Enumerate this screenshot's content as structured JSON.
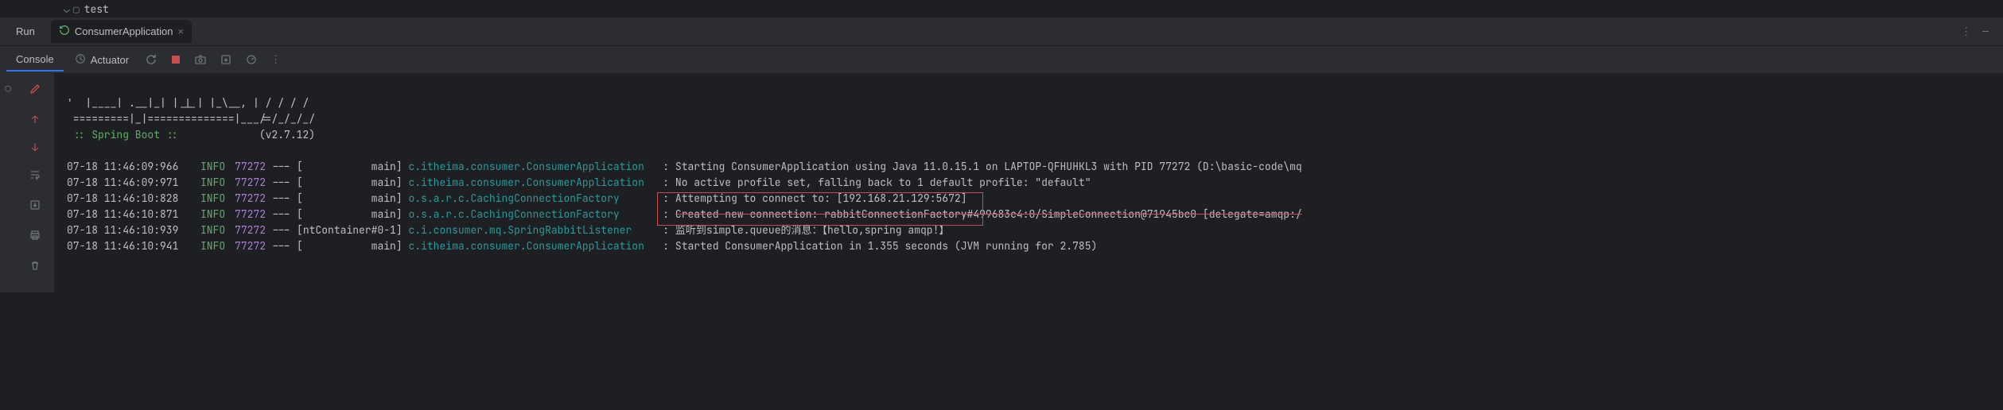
{
  "tree": {
    "folder": "test"
  },
  "toolWindow": {
    "runLabel": "Run",
    "appName": "ConsumerApplication"
  },
  "consoleBar": {
    "consoleTab": "Console",
    "actuator": "Actuator"
  },
  "banner": {
    "line1": "'  |____| .__|_| |_|_| |_\\__, | / / / /",
    "line2": " =========|_|==============|___/=/_/_/_/",
    "springLabel": " :: Spring Boot ::",
    "version": "(v2.7.12)"
  },
  "logLines": [
    {
      "ts": "07-18 11:46:09:966",
      "level": "INFO",
      "pid": "77272",
      "thread": "           main",
      "logger": "c.itheima.consumer.ConsumerApplication  ",
      "msg": "Starting ConsumerApplication using Java 11.0.15.1 on LAPTOP-QFHUHKL3 with PID 77272 (D:\\basic-code\\mq"
    },
    {
      "ts": "07-18 11:46:09:971",
      "level": "INFO",
      "pid": "77272",
      "thread": "           main",
      "logger": "c.itheima.consumer.ConsumerApplication  ",
      "msg": "No active profile set, falling back to 1 default profile: \"default\""
    },
    {
      "ts": "07-18 11:46:10:828",
      "level": "INFO",
      "pid": "77272",
      "thread": "           main",
      "logger": "o.s.a.r.c.CachingConnectionFactory      ",
      "msg": "Attempting to connect to: [192.168.21.129:5672]"
    },
    {
      "ts": "07-18 11:46:10:871",
      "level": "INFO",
      "pid": "77272",
      "thread": "           main",
      "logger": "o.s.a.r.c.CachingConnectionFactory      ",
      "msg": "Created new connection: rabbitConnectionFactory#499683c4:0/SimpleConnection@71945bc0 [delegate=amqp:/",
      "strike": true
    },
    {
      "ts": "07-18 11:46:10:939",
      "level": "INFO",
      "pid": "77272",
      "thread": "ntContainer#0-1",
      "logger": "c.i.consumer.mq.SpringRabbitListener    ",
      "msg": "监听到simple.queue的消息：【hello,spring amqp!】"
    },
    {
      "ts": "07-18 11:46:10:941",
      "level": "INFO",
      "pid": "77272",
      "thread": "           main",
      "logger": "c.itheima.consumer.ConsumerApplication  ",
      "msg": "Started ConsumerApplication in 1.355 seconds (JVM running for 2.785)"
    }
  ]
}
